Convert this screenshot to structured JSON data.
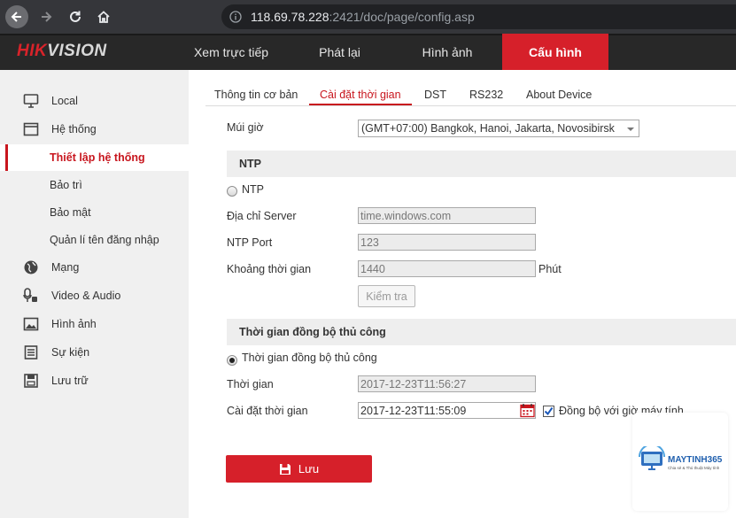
{
  "browser": {
    "url_host": "118.69.78.228",
    "url_path": ":2421/doc/page/config.asp"
  },
  "brand": {
    "part1": "HIK",
    "part2": "VISION"
  },
  "top_nav": [
    {
      "label": "Xem trực tiếp"
    },
    {
      "label": "Phát lại"
    },
    {
      "label": "Hình ảnh"
    },
    {
      "label": "Cấu hình",
      "active": true
    }
  ],
  "sidebar": {
    "items": [
      {
        "label": "Local",
        "icon": "monitor-icon"
      },
      {
        "label": "Hệ thống",
        "icon": "system-window-icon"
      },
      {
        "label": "Thiết lập hệ thống",
        "selected": true
      },
      {
        "label": "Bảo trì"
      },
      {
        "label": "Bảo mật"
      },
      {
        "label": "Quản lí tên đăng nhập"
      },
      {
        "label": "Mạng",
        "icon": "globe-icon"
      },
      {
        "label": "Video & Audio",
        "icon": "mic-camera-icon"
      },
      {
        "label": "Hình ảnh",
        "icon": "image-icon"
      },
      {
        "label": "Sự kiện",
        "icon": "event-list-icon"
      },
      {
        "label": "Lưu trữ",
        "icon": "storage-icon"
      }
    ]
  },
  "subtabs": [
    {
      "label": "Thông tin cơ bản"
    },
    {
      "label": "Cài đặt thời gian",
      "active": true
    },
    {
      "label": "DST"
    },
    {
      "label": "RS232"
    },
    {
      "label": "About Device"
    }
  ],
  "form": {
    "timezone_label": "Múi giờ",
    "timezone_value": "(GMT+07:00) Bangkok, Hanoi, Jakarta, Novosibirsk",
    "ntp_section": "NTP",
    "ntp_radio_label": "NTP",
    "server_label": "Địa chỉ Server",
    "server_value": "time.windows.com",
    "port_label": "NTP Port",
    "port_value": "123",
    "interval_label": "Khoảng thời gian",
    "interval_value": "1440",
    "interval_unit": "Phút",
    "test_button": "Kiểm tra",
    "manual_section": "Thời gian đồng bộ thủ công",
    "manual_radio_label": "Thời gian đồng bộ thủ công",
    "device_time_label": "Thời gian",
    "device_time_value": "2017-12-23T11:56:27",
    "set_time_label": "Cài đặt thời gian",
    "set_time_value": "2017-12-23T11:55:09",
    "sync_pc_label": "Đồng bộ với giờ máy tính",
    "sync_pc_checked": true,
    "save_button": "Lưu"
  },
  "watermark": {
    "brand": "MAYTINH365",
    "tagline": "Chia sẻ & Thủ thuật Máy tính"
  },
  "colors": {
    "accent": "#d6202a",
    "header_bg": "#282828",
    "sidebar_bg": "#f0f0f0"
  }
}
